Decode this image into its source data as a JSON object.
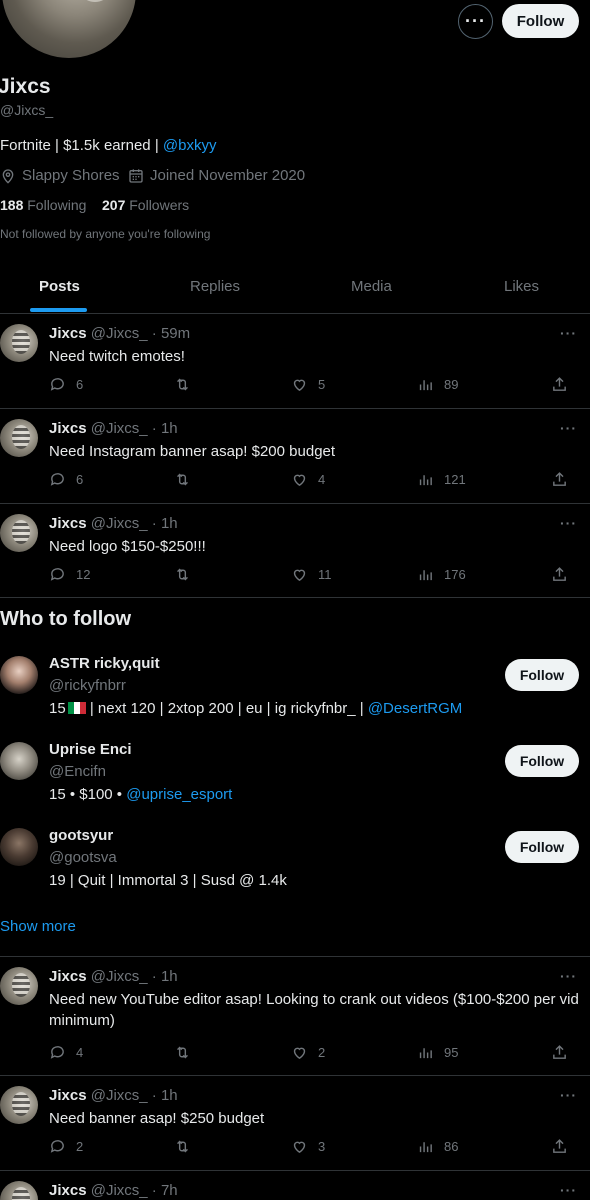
{
  "profile": {
    "name": "Jixcs",
    "handle": "@Jixcs_",
    "bio_text": "Fortnite | $1.5k earned | ",
    "bio_link": "@bxkyy",
    "location": "Slappy Shores",
    "joined": "Joined November 2020",
    "following_count": "188",
    "following_label": "Following",
    "followers_count": "207",
    "followers_label": "Followers",
    "not_followed": "Not followed by anyone you're following",
    "follow_label": "Follow",
    "more_label": "···"
  },
  "tabs": [
    {
      "label": "Posts",
      "active": true
    },
    {
      "label": "Replies",
      "active": false
    },
    {
      "label": "Media",
      "active": false
    },
    {
      "label": "Likes",
      "active": false
    }
  ],
  "posts": [
    {
      "name": "Jixcs",
      "meta": "@Jixcs_ · 59m",
      "text": "Need twitch emotes!",
      "replies": "6",
      "reposts": "",
      "likes": "5",
      "views": "89"
    },
    {
      "name": "Jixcs",
      "meta": "@Jixcs_ · 1h",
      "text": "Need Instagram banner asap! $200 budget",
      "replies": "6",
      "reposts": "",
      "likes": "4",
      "views": "121"
    },
    {
      "name": "Jixcs",
      "meta": "@Jixcs_ · 1h",
      "text": "Need logo $150-$250!!!",
      "replies": "12",
      "reposts": "",
      "likes": "11",
      "views": "176"
    },
    {
      "name": "Jixcs",
      "meta": "@Jixcs_ · 1h",
      "text": "Need new YouTube editor asap! Looking to crank out videos ($100-$200 per vid minimum)",
      "replies": "4",
      "reposts": "",
      "likes": "2",
      "views": "95"
    },
    {
      "name": "Jixcs",
      "meta": "@Jixcs_ · 1h",
      "text": "Need banner asap! $250 budget",
      "replies": "2",
      "reposts": "",
      "likes": "3",
      "views": "86"
    },
    {
      "name": "Jixcs",
      "meta": "@Jixcs_ · 7h"
    }
  ],
  "who_to_follow": {
    "title": "Who to follow",
    "show_more": "Show more",
    "follow_label": "Follow",
    "users": [
      {
        "name": "ASTR ricky,quit",
        "handle": "@rickyfnbrr",
        "bio_a": "15",
        "bio_b": " | next 120 | 2xtop 200 | eu | ig rickyfnbr_ | ",
        "bio_link": "@DesertRGM"
      },
      {
        "name": "Uprise Enci",
        "handle": "@Encifn",
        "bio_a": "15 • $100 • ",
        "bio_link": "@uprise_esport"
      },
      {
        "name": "gootsyur",
        "handle": "@gootsva",
        "bio_a": "19 | Quit | Immortal 3 | Susd @ 1.4k"
      }
    ]
  },
  "colors": {
    "accent": "#1d9bf0",
    "muted": "#71767b",
    "text": "#e7e9ea",
    "border": "#2f3336"
  }
}
